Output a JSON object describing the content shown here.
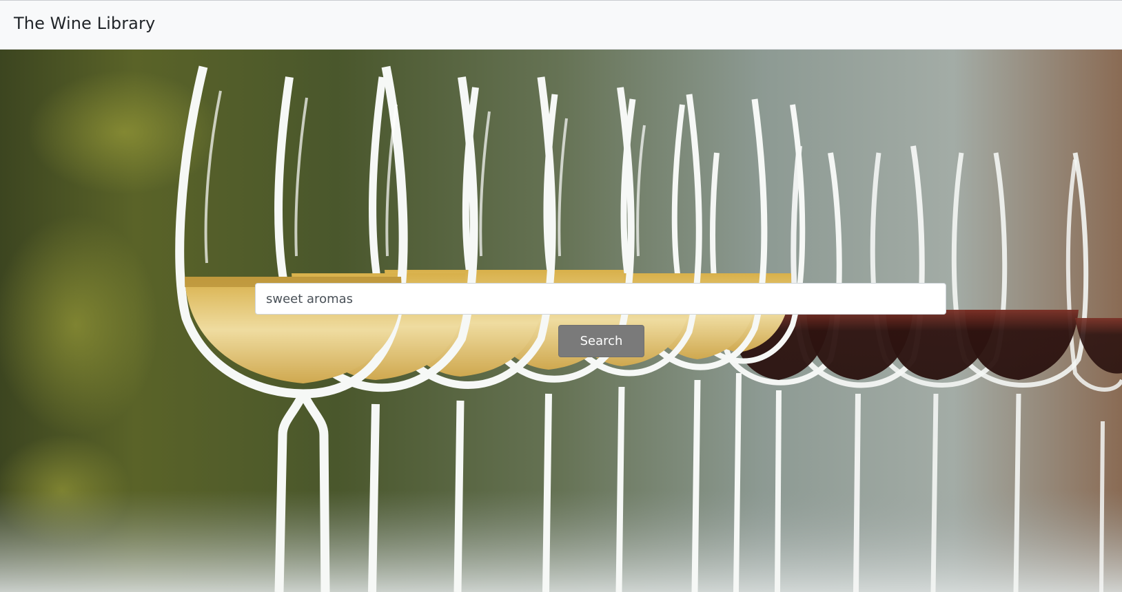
{
  "navbar": {
    "brand": "The Wine Library"
  },
  "hero": {
    "background": "photo of a row of wine glasses: white wine in the front glasses, red wine in the rear glasses, blurred green background",
    "search": {
      "value": "sweet aromas",
      "placeholder": ""
    },
    "search_button_label": "Search"
  },
  "colors": {
    "navbar_bg": "#f8f9fa",
    "button_bg": "#7a7a7a",
    "button_text": "#ffffff",
    "input_bg": "#ffffff",
    "white_wine": "#e2c36a",
    "red_wine": "#3a1814"
  }
}
